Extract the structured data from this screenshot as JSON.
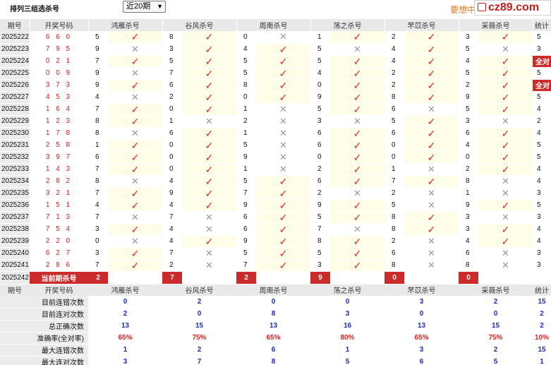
{
  "header": {
    "title": "排列三组选杀号",
    "period_select": "近20期",
    "promo": "要想中大",
    "watermark": "cz89.com"
  },
  "columns": [
    "期号",
    "开奖号码",
    "鸿雁杀号",
    "谷风杀号",
    "周南杀号",
    "荡之杀号",
    "芣苡杀号",
    "采薇杀号",
    "统计"
  ],
  "rows": [
    {
      "period": "2025222",
      "number": "6 6 0",
      "picks": [
        [
          "5",
          "Y"
        ],
        [
          "8",
          "Y"
        ],
        [
          "0",
          "N"
        ],
        [
          "1",
          "Y"
        ],
        [
          "2",
          "Y"
        ],
        [
          "3",
          "Y"
        ]
      ],
      "stat": "5",
      "full": false
    },
    {
      "period": "2025223",
      "number": "7 9 5",
      "picks": [
        [
          "9",
          "N"
        ],
        [
          "3",
          "Y"
        ],
        [
          "4",
          "Y"
        ],
        [
          "5",
          "N"
        ],
        [
          "4",
          "Y"
        ],
        [
          "5",
          "N"
        ]
      ],
      "stat": "3",
      "full": false
    },
    {
      "period": "2025224",
      "number": "0 2 1",
      "picks": [
        [
          "7",
          "Y"
        ],
        [
          "5",
          "Y"
        ],
        [
          "5",
          "Y"
        ],
        [
          "5",
          "Y"
        ],
        [
          "4",
          "Y"
        ],
        [
          "4",
          "Y"
        ]
      ],
      "stat": "全对",
      "full": true
    },
    {
      "period": "2025225",
      "number": "0 0 9",
      "picks": [
        [
          "9",
          "N"
        ],
        [
          "7",
          "Y"
        ],
        [
          "5",
          "Y"
        ],
        [
          "4",
          "Y"
        ],
        [
          "2",
          "Y"
        ],
        [
          "5",
          "Y"
        ]
      ],
      "stat": "5",
      "full": false
    },
    {
      "period": "2025226",
      "number": "3 7 3",
      "picks": [
        [
          "9",
          "Y"
        ],
        [
          "6",
          "Y"
        ],
        [
          "8",
          "Y"
        ],
        [
          "0",
          "Y"
        ],
        [
          "2",
          "Y"
        ],
        [
          "2",
          "Y"
        ]
      ],
      "stat": "全对",
      "full": true
    },
    {
      "period": "2025227",
      "number": "4 5 3",
      "picks": [
        [
          "4",
          "N"
        ],
        [
          "2",
          "Y"
        ],
        [
          "0",
          "Y"
        ],
        [
          "9",
          "Y"
        ],
        [
          "8",
          "Y"
        ],
        [
          "9",
          "Y"
        ]
      ],
      "stat": "5",
      "full": false
    },
    {
      "period": "2025228",
      "number": "1 6 4",
      "picks": [
        [
          "7",
          "Y"
        ],
        [
          "0",
          "Y"
        ],
        [
          "1",
          "N"
        ],
        [
          "5",
          "Y"
        ],
        [
          "6",
          "N"
        ],
        [
          "5",
          "Y"
        ]
      ],
      "stat": "4",
      "full": false
    },
    {
      "period": "2025229",
      "number": "1 2 3",
      "picks": [
        [
          "8",
          "Y"
        ],
        [
          "1",
          "N"
        ],
        [
          "2",
          "N"
        ],
        [
          "3",
          "N"
        ],
        [
          "5",
          "Y"
        ],
        [
          "3",
          "N"
        ]
      ],
      "stat": "2",
      "full": false
    },
    {
      "period": "2025230",
      "number": "1 7 8",
      "picks": [
        [
          "8",
          "N"
        ],
        [
          "6",
          "Y"
        ],
        [
          "1",
          "N"
        ],
        [
          "6",
          "Y"
        ],
        [
          "6",
          "Y"
        ],
        [
          "6",
          "Y"
        ]
      ],
      "stat": "4",
      "full": false
    },
    {
      "period": "2025231",
      "number": "2 5 8",
      "picks": [
        [
          "1",
          "Y"
        ],
        [
          "0",
          "Y"
        ],
        [
          "5",
          "N"
        ],
        [
          "6",
          "Y"
        ],
        [
          "0",
          "Y"
        ],
        [
          "4",
          "Y"
        ]
      ],
      "stat": "5",
      "full": false
    },
    {
      "period": "2025232",
      "number": "3 9 7",
      "picks": [
        [
          "6",
          "Y"
        ],
        [
          "0",
          "Y"
        ],
        [
          "9",
          "N"
        ],
        [
          "0",
          "Y"
        ],
        [
          "0",
          "Y"
        ],
        [
          "0",
          "Y"
        ]
      ],
      "stat": "5",
      "full": false
    },
    {
      "period": "2025233",
      "number": "1 4 3",
      "picks": [
        [
          "7",
          "Y"
        ],
        [
          "0",
          "Y"
        ],
        [
          "1",
          "N"
        ],
        [
          "2",
          "Y"
        ],
        [
          "1",
          "N"
        ],
        [
          "2",
          "Y"
        ]
      ],
      "stat": "4",
      "full": false
    },
    {
      "period": "2025234",
      "number": "2 8 2",
      "picks": [
        [
          "8",
          "N"
        ],
        [
          "4",
          "Y"
        ],
        [
          "5",
          "Y"
        ],
        [
          "6",
          "Y"
        ],
        [
          "7",
          "Y"
        ],
        [
          "8",
          "N"
        ]
      ],
      "stat": "4",
      "full": false
    },
    {
      "period": "2025235",
      "number": "3 2 1",
      "picks": [
        [
          "7",
          "Y"
        ],
        [
          "9",
          "Y"
        ],
        [
          "7",
          "Y"
        ],
        [
          "2",
          "N"
        ],
        [
          "2",
          "N"
        ],
        [
          "1",
          "N"
        ]
      ],
      "stat": "3",
      "full": false
    },
    {
      "period": "2025236",
      "number": "1 5 1",
      "picks": [
        [
          "4",
          "Y"
        ],
        [
          "4",
          "Y"
        ],
        [
          "9",
          "Y"
        ],
        [
          "9",
          "Y"
        ],
        [
          "5",
          "N"
        ],
        [
          "9",
          "Y"
        ]
      ],
      "stat": "5",
      "full": false
    },
    {
      "period": "2025237",
      "number": "7 1 3",
      "picks": [
        [
          "7",
          "N"
        ],
        [
          "7",
          "N"
        ],
        [
          "6",
          "Y"
        ],
        [
          "5",
          "Y"
        ],
        [
          "8",
          "Y"
        ],
        [
          "3",
          "N"
        ]
      ],
      "stat": "3",
      "full": false
    },
    {
      "period": "2025238",
      "number": "7 5 4",
      "picks": [
        [
          "3",
          "Y"
        ],
        [
          "4",
          "N"
        ],
        [
          "6",
          "Y"
        ],
        [
          "7",
          "N"
        ],
        [
          "8",
          "Y"
        ],
        [
          "3",
          "Y"
        ]
      ],
      "stat": "4",
      "full": false
    },
    {
      "period": "2025239",
      "number": "2 2 0",
      "picks": [
        [
          "0",
          "N"
        ],
        [
          "4",
          "Y"
        ],
        [
          "9",
          "Y"
        ],
        [
          "8",
          "Y"
        ],
        [
          "2",
          "N"
        ],
        [
          "4",
          "Y"
        ]
      ],
      "stat": "4",
      "full": false
    },
    {
      "period": "2025240",
      "number": "6 2 7",
      "picks": [
        [
          "3",
          "Y"
        ],
        [
          "7",
          "N"
        ],
        [
          "5",
          "Y"
        ],
        [
          "5",
          "Y"
        ],
        [
          "6",
          "N"
        ],
        [
          "6",
          "N"
        ]
      ],
      "stat": "3",
      "full": false
    },
    {
      "period": "2025241",
      "number": "2 8 6",
      "picks": [
        [
          "7",
          "Y"
        ],
        [
          "2",
          "N"
        ],
        [
          "7",
          "Y"
        ],
        [
          "3",
          "Y"
        ],
        [
          "8",
          "N"
        ],
        [
          "8",
          "N"
        ]
      ],
      "stat": "3",
      "full": false
    }
  ],
  "current": {
    "period": "2025242",
    "label": "当前期杀号",
    "picks": [
      "2",
      "7",
      "2",
      "9",
      "0",
      "0"
    ]
  },
  "summary_rows": [
    {
      "label": "目前连错次数",
      "values": [
        "0",
        "2",
        "0",
        "0",
        "3",
        "2",
        "15"
      ],
      "red": false
    },
    {
      "label": "目前连对次数",
      "values": [
        "2",
        "0",
        "8",
        "3",
        "0",
        "0",
        "2"
      ],
      "red": false
    },
    {
      "label": "总正确次数",
      "values": [
        "13",
        "15",
        "13",
        "16",
        "13",
        "15",
        "2"
      ],
      "red": false
    },
    {
      "label": "准确率(全对率)",
      "values": [
        "65%",
        "75%",
        "65%",
        "80%",
        "65%",
        "75%",
        "10%"
      ],
      "red": true
    },
    {
      "label": "最大连错次数",
      "values": [
        "1",
        "2",
        "6",
        "1",
        "3",
        "2",
        "15"
      ],
      "red": false
    },
    {
      "label": "最大连对次数",
      "values": [
        "3",
        "7",
        "8",
        "5",
        "6",
        "5",
        "1"
      ],
      "red": false
    }
  ],
  "marks": {
    "hit": "✓",
    "miss": "✕"
  },
  "colors": {
    "accent_red": "#cc2b2b",
    "hit_red": "#e02020",
    "summary_blue": "#1a2fb3",
    "promo_orange": "#e87722"
  }
}
